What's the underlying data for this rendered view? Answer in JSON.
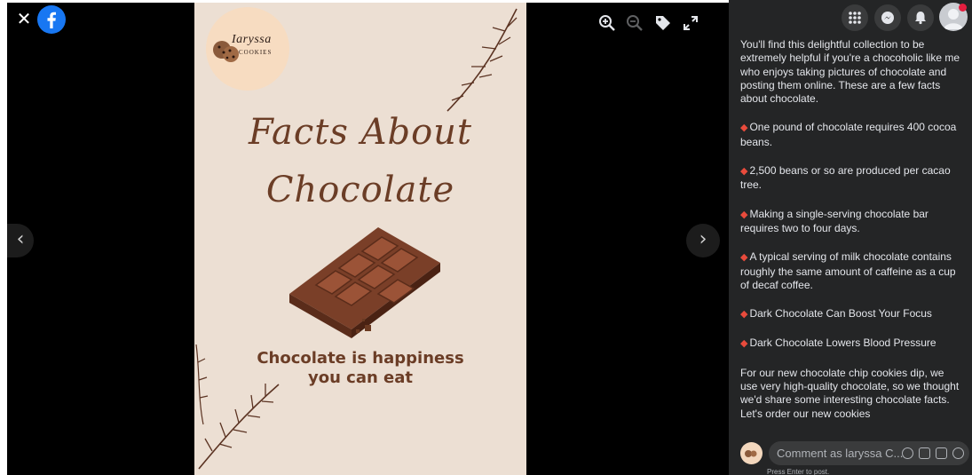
{
  "viewer": {
    "close_glyph": "✕",
    "prev_glyph": "‹",
    "next_glyph": "›"
  },
  "photo": {
    "brand_name": "Iaryssa",
    "brand_sub": "COOKIES",
    "headline_line1": "Facts About",
    "headline_line2": "Chocolate",
    "tagline_line1": "Chocolate is happiness",
    "tagline_line2": "you can eat"
  },
  "panel": {
    "post_intro": "You'll find this delightful collection to be extremely helpful if you're a chocoholic like me who enjoys taking pictures of chocolate and posting them online. These are a few facts about chocolate.",
    "facts": [
      "One pound of chocolate requires 400 cocoa beans.",
      "2,500 beans or so are produced per cacao tree.",
      "Making a single-serving chocolate bar requires two to four days.",
      "A typical serving of milk chocolate contains roughly the same amount of caffeine as a cup of decaf coffee.",
      "Dark Chocolate Can Boost Your Focus",
      "Dark Chocolate Lowers Blood Pressure"
    ],
    "closing_line1": "For our new chocolate chip cookies dip, we use very high-quality chocolate, so we thought we'd share some interesting chocolate facts.",
    "closing_line2": "Let's order our new cookies",
    "comment_placeholder": "Comment as laryssa C...",
    "hint": "Press Enter to post."
  },
  "colors": {
    "brand_blue": "#1877f2",
    "panel_bg": "#242526",
    "photo_bg": "#ecdfd3",
    "chocolate": "#6b3d26",
    "notification": "#e41e3f"
  },
  "icons": [
    "close-icon",
    "facebook-logo",
    "zoom-in-icon",
    "zoom-out-icon",
    "tag-icon",
    "fullscreen-icon",
    "menu-grid-icon",
    "messenger-icon",
    "notifications-icon",
    "profile-avatar",
    "emoji-icon",
    "camera-icon",
    "gif-icon",
    "sticker-icon"
  ]
}
